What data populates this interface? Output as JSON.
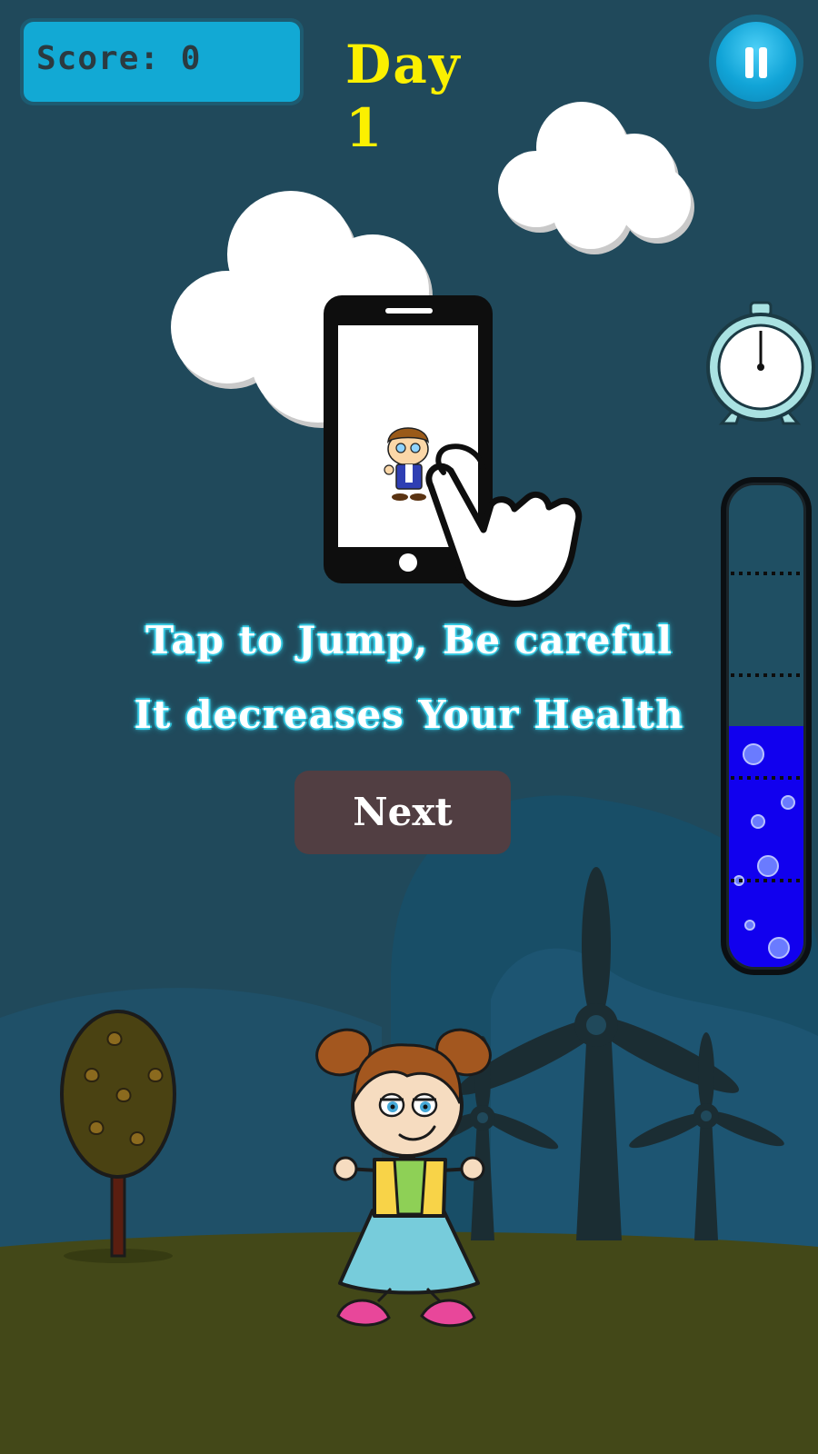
{
  "hud": {
    "score_text": "Score: 0",
    "day_text": "Day 1"
  },
  "tutorial": {
    "line1": "Tap to Jump, Be careful",
    "line2": "It decreases Your Health",
    "next_label": "Next"
  },
  "health_meter": {
    "fill_level": 0.5,
    "fill_color": "#1100ee"
  },
  "colors": {
    "background": "#20495b",
    "score_panel": "#12a9d4",
    "day_text": "#fbf000",
    "next_button": "#513e42",
    "grass": "#434818"
  },
  "icons": {
    "pause": "pause-icon",
    "timer": "alarm-clock-icon",
    "tutorial": "phone-tap-icon"
  }
}
